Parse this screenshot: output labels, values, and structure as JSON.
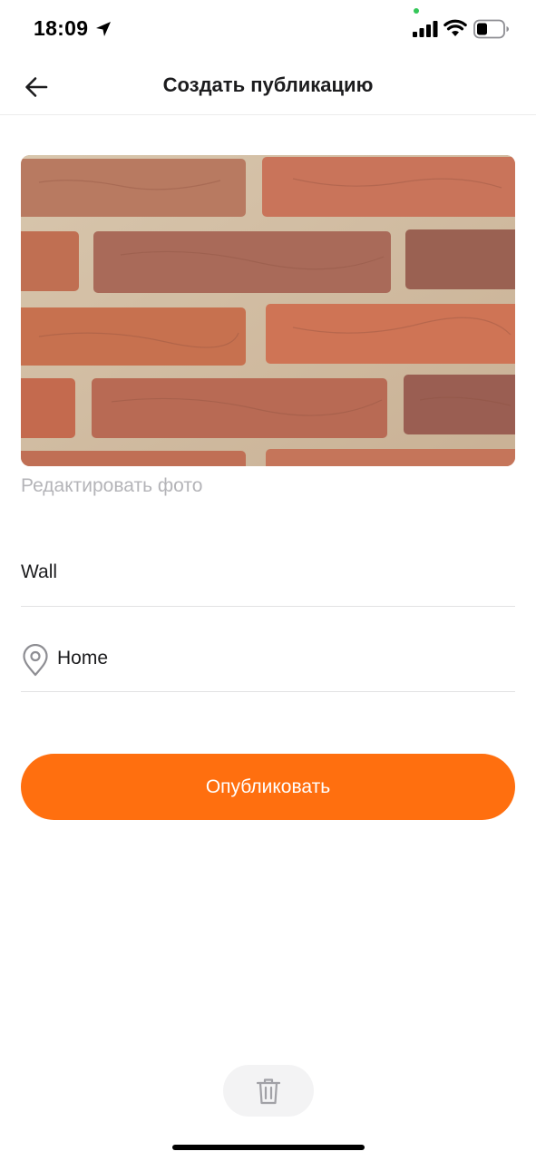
{
  "status_bar": {
    "time": "18:09",
    "icons": [
      "location-arrow-icon",
      "signal-icon",
      "wifi-icon",
      "battery-icon"
    ]
  },
  "nav": {
    "title": "Создать публикацию",
    "back_icon": "arrow-left-icon"
  },
  "photo": {
    "subject": "brick-wall-photo",
    "edit_label": "Редактировать фото"
  },
  "form": {
    "title_value": "Wall",
    "location_icon": "location-pin-icon",
    "location_value": "Home"
  },
  "actions": {
    "publish_label": "Опубликовать",
    "delete_icon": "trash-icon"
  },
  "colors": {
    "accent": "#ff6f0f",
    "muted_text": "#b4b4b8",
    "divider": "#e2e2e4",
    "privacy_dot": "#34c759"
  }
}
